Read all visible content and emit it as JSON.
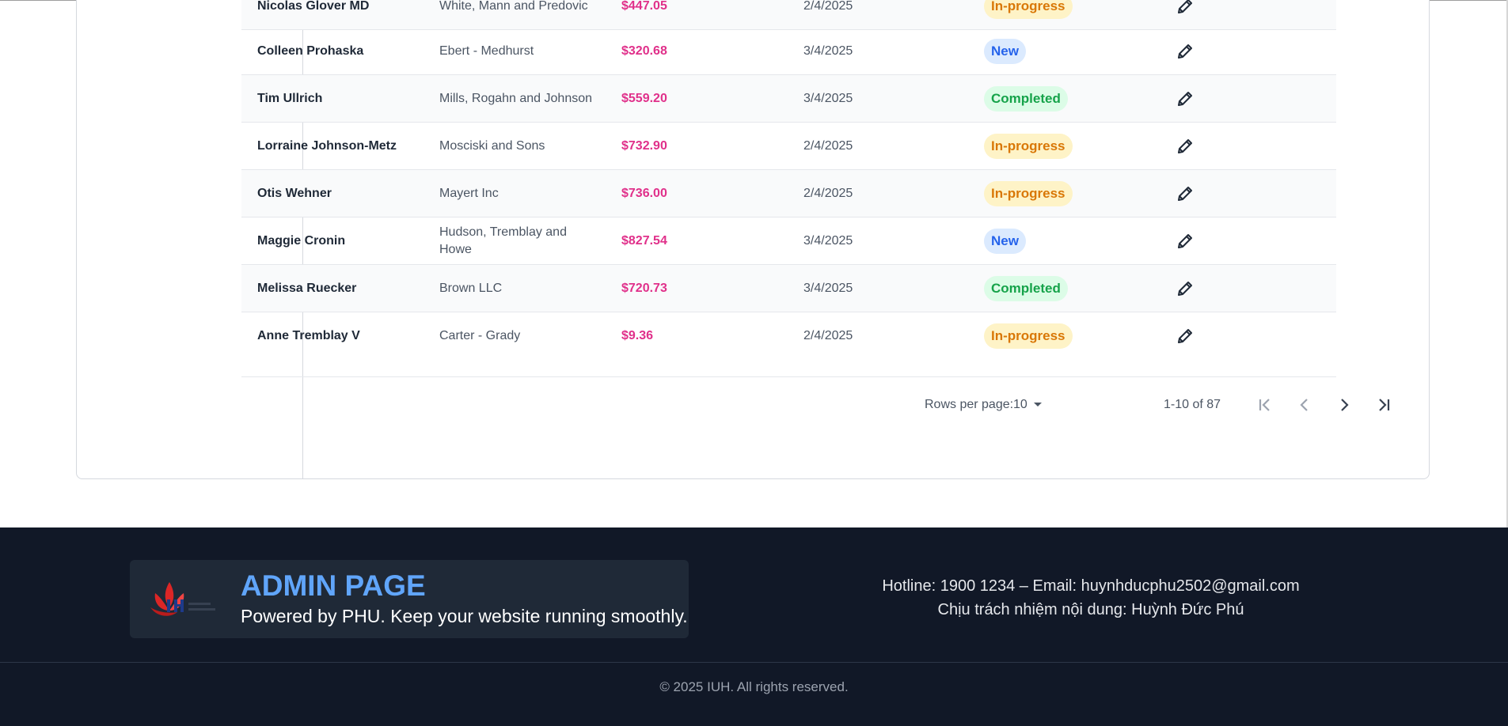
{
  "orders": [
    {
      "name": "Nicolas Glover MD",
      "company": "White, Mann and Predovic",
      "amount": "$447.05",
      "date": "2/4/2025",
      "status": "In-progress",
      "status_key": "in-progress"
    },
    {
      "name": "Colleen Prohaska",
      "company": "Ebert - Medhurst",
      "amount": "$320.68",
      "date": "3/4/2025",
      "status": "New",
      "status_key": "new"
    },
    {
      "name": "Tim Ullrich",
      "company": "Mills, Rogahn and Johnson",
      "amount": "$559.20",
      "date": "3/4/2025",
      "status": "Completed",
      "status_key": "completed"
    },
    {
      "name": "Lorraine Johnson-Metz",
      "company": "Mosciski and Sons",
      "amount": "$732.90",
      "date": "2/4/2025",
      "status": "In-progress",
      "status_key": "in-progress"
    },
    {
      "name": "Otis Wehner",
      "company": "Mayert Inc",
      "amount": "$736.00",
      "date": "2/4/2025",
      "status": "In-progress",
      "status_key": "in-progress"
    },
    {
      "name": "Maggie Cronin",
      "company": "Hudson, Tremblay and Howe",
      "amount": "$827.54",
      "date": "3/4/2025",
      "status": "New",
      "status_key": "new"
    },
    {
      "name": "Melissa Ruecker",
      "company": "Brown LLC",
      "amount": "$720.73",
      "date": "3/4/2025",
      "status": "Completed",
      "status_key": "completed"
    },
    {
      "name": "Anne Tremblay V",
      "company": "Carter - Grady",
      "amount": "$9.36",
      "date": "2/4/2025",
      "status": "In-progress",
      "status_key": "in-progress"
    }
  ],
  "row_action_icon": "pencil-icon",
  "pagination": {
    "rows_per_page_label": "Rows per page:",
    "rows_per_page_value": "10",
    "range": "1-10 of 87",
    "first_icon": "first-page-icon",
    "prev_icon": "chevron-left-icon",
    "next_icon": "chevron-right-icon",
    "last_icon": "last-page-icon"
  },
  "footer": {
    "title": "ADMIN PAGE",
    "tagline": "Powered by PHU. Keep your website running smoothly.",
    "hotline": "Hotline: 1900 1234 – Email: huynhducphu2502@gmail.com",
    "responsible": "Chịu trách nhiệm nội dung: Huỳnh Đức Phú",
    "copyright": "© 2025 IUH. All rights reserved."
  },
  "colors": {
    "amount": "#e0308a",
    "footer_bg": "#111827",
    "title_accent": "#60a5fa"
  }
}
